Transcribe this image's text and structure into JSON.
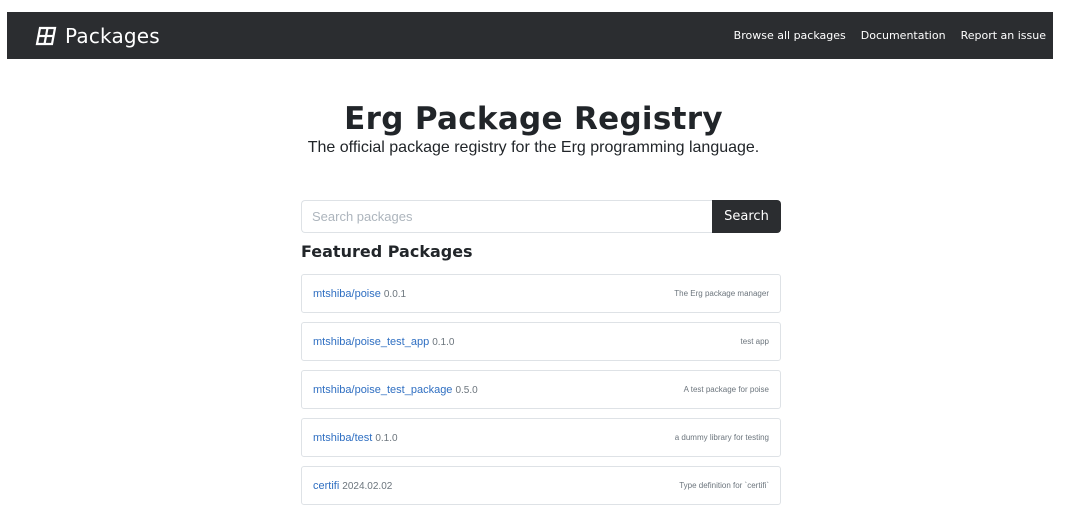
{
  "navbar": {
    "brand_label": "Packages",
    "brand_icon": "grid-logo-icon",
    "links": [
      {
        "label": "Browse all packages"
      },
      {
        "label": "Documentation"
      },
      {
        "label": "Report an issue"
      }
    ]
  },
  "hero": {
    "title": "Erg Package Registry",
    "subtitle": "The official package registry for the Erg programming language."
  },
  "search": {
    "placeholder": "Search packages",
    "value": "",
    "button_label": "Search"
  },
  "featured": {
    "title": "Featured Packages",
    "packages": [
      {
        "name": "mtshiba/poise",
        "version": "0.0.1",
        "description": "The Erg package manager"
      },
      {
        "name": "mtshiba/poise_test_app",
        "version": "0.1.0",
        "description": "test app"
      },
      {
        "name": "mtshiba/poise_test_package",
        "version": "0.5.0",
        "description": "A test package for poise"
      },
      {
        "name": "mtshiba/test",
        "version": "0.1.0",
        "description": "a dummy library for testing"
      },
      {
        "name": "certifi",
        "version": "2024.02.02",
        "description": "Type definition for `certifi`"
      }
    ]
  },
  "colors": {
    "navbar_bg": "#2b2d30",
    "link": "#2f6fc2",
    "muted": "#6c757d",
    "border": "#dee2e6"
  }
}
